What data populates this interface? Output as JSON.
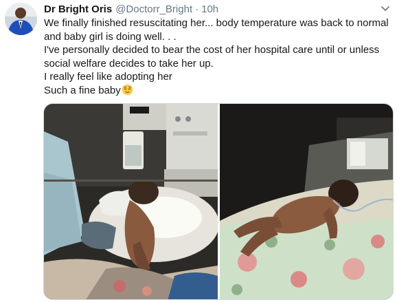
{
  "tweet": {
    "display_name": "Dr Bright Oris",
    "handle": "@Doctorr_Bright",
    "separator": "·",
    "timestamp": "10h",
    "lines": [
      "We finally finished resuscitating her... body temperature was back to normal",
      "and baby girl is doing well. . .",
      "I've personally decided to bear the cost of her hospital care until or unless",
      "social welfare decides to take her up.",
      "I really feel like adopting her",
      "Such a fine baby"
    ],
    "emoji_icon": "relieved-face-icon"
  },
  "icons": {
    "more": "chevron-down-icon",
    "avatar": "avatar"
  },
  "colors": {
    "text": "#14171a",
    "secondary": "#657786",
    "border": "#ccd6dd"
  }
}
